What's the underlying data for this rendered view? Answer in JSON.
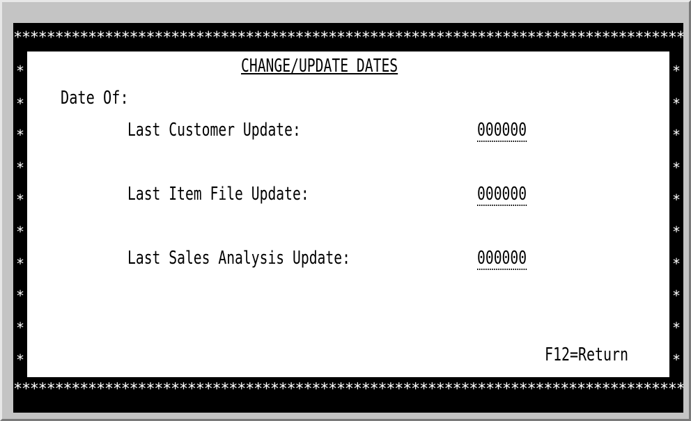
{
  "screen": {
    "border_char": "*",
    "title": "CHANGE/UPDATE DATES",
    "section_label": "Date Of:",
    "fields": [
      {
        "label": "Last Customer Update:",
        "value": "000000"
      },
      {
        "label": "Last Item File Update:",
        "value": "000000"
      },
      {
        "label": "Last Sales Analysis Update:",
        "value": "000000"
      }
    ],
    "footer_key": "F12=Return"
  },
  "colors": {
    "screen_background": "#000000",
    "panel_background": "#ffffff",
    "text": "#000000",
    "border_stars": "#ffffff"
  }
}
